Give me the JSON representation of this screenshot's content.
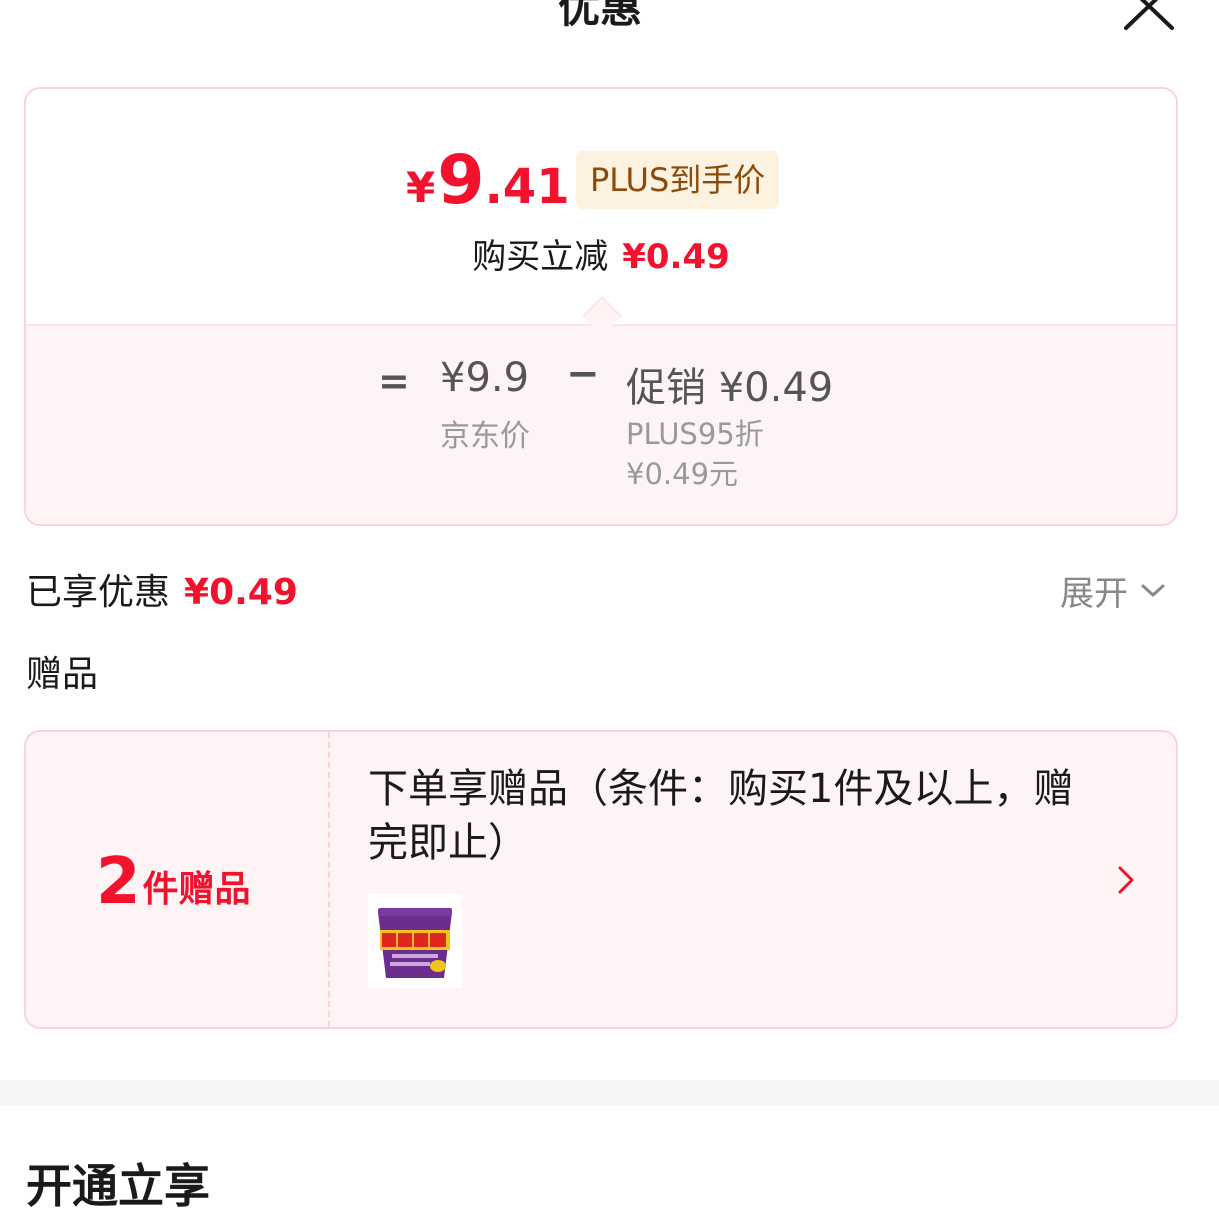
{
  "header": {
    "title": "优惠",
    "close_icon": "close-icon"
  },
  "price_summary": {
    "currency": "¥",
    "price_int": "9",
    "price_dec": ".41",
    "plus_tag": "PLUS到手价",
    "reduce_label": "购买立减",
    "reduce_value": "¥0.49",
    "formula": {
      "equals": "=",
      "jd_price": "¥9.9",
      "jd_label": "京东价",
      "minus": "−",
      "promo_value": "促销 ¥0.49",
      "promo_sub1": "PLUS95折",
      "promo_sub2": "¥0.49元"
    }
  },
  "enjoyed": {
    "label": "已享优惠",
    "value": "¥0.49",
    "expand_label": "展开"
  },
  "gift": {
    "heading": "赠品",
    "count": "2",
    "count_unit": "件赠品",
    "description": "下单享赠品（条件：购买1件及以上，赠完即止）",
    "thumb_icon": "noodle-cup-image"
  },
  "open": {
    "heading": "开通立享"
  },
  "colors": {
    "accent_red": "#f2122d",
    "plus_gold": "#8a4a0b",
    "card_border": "#fcd2da"
  }
}
